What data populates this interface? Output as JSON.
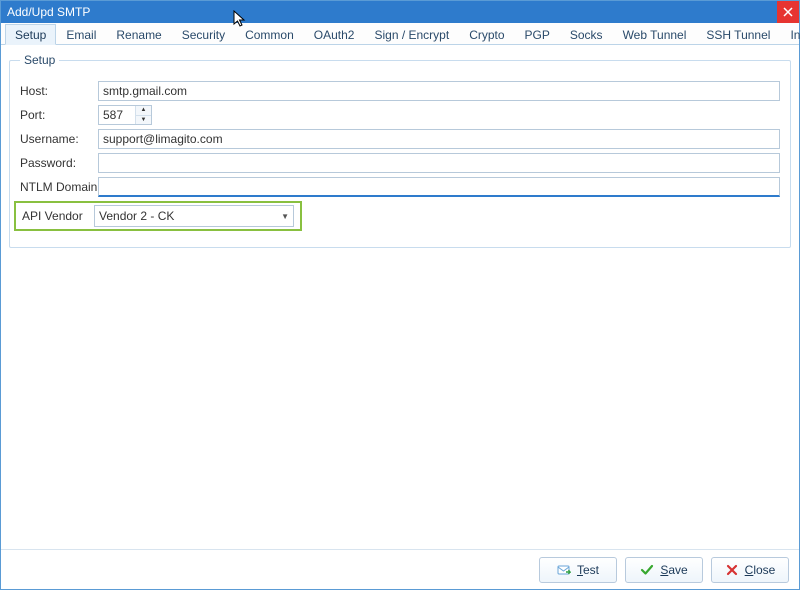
{
  "window": {
    "title": "Add/Upd SMTP"
  },
  "tabs": [
    {
      "label": "Setup",
      "active": true
    },
    {
      "label": "Email"
    },
    {
      "label": "Rename"
    },
    {
      "label": "Security"
    },
    {
      "label": "Common"
    },
    {
      "label": "OAuth2"
    },
    {
      "label": "Sign / Encrypt"
    },
    {
      "label": "Crypto"
    },
    {
      "label": "PGP"
    },
    {
      "label": "Socks"
    },
    {
      "label": "Web Tunnel"
    },
    {
      "label": "SSH Tunnel"
    },
    {
      "label": "Info"
    }
  ],
  "group": {
    "legend": "Setup"
  },
  "form": {
    "host": {
      "label": "Host:",
      "value": "smtp.gmail.com"
    },
    "port": {
      "label": "Port:",
      "value": "587"
    },
    "username": {
      "label": "Username:",
      "value": "support@limagito.com"
    },
    "password": {
      "label": "Password:",
      "value": ""
    },
    "ntlmdomain": {
      "label": "NTLM Domain",
      "value": ""
    },
    "apivendor": {
      "label": "API Vendor",
      "value": "Vendor 2 - CK"
    }
  },
  "footer": {
    "test": {
      "label": "Test",
      "mn": "T"
    },
    "save": {
      "label": "Save",
      "mn": "S"
    },
    "close": {
      "label": "Close",
      "mn": "C"
    }
  }
}
